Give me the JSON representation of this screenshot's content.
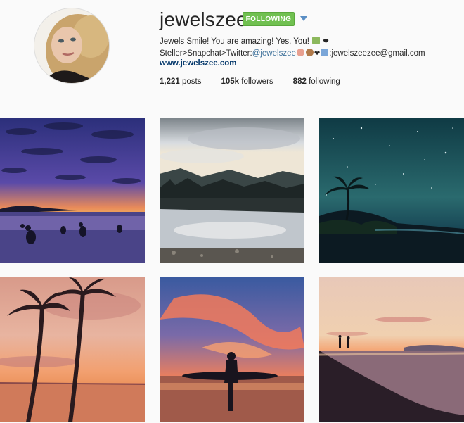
{
  "profile": {
    "username": "jewelszee",
    "follow_button_label": "FOLLOWING",
    "bio_line1": "Jewels Smile! You are amazing! Yes, You!",
    "bio_line2_prefix": "Steller>Snapchat>Twitter:",
    "bio_twitter": "@jewelszee",
    "bio_email": ":jewelszeezee@gmail.com",
    "website": "www.jewelszee.com"
  },
  "stats": {
    "posts_count": "1,221",
    "posts_label": "posts",
    "followers_count": "105k",
    "followers_label": "followers",
    "following_count": "882",
    "following_label": "following"
  },
  "colors": {
    "follow_green": "#70c050",
    "link_blue": "#3f729b",
    "website_blue": "#003569"
  },
  "posts": [
    {
      "scene": "sunset beach with kangaroos"
    },
    {
      "scene": "mountain lake reflection"
    },
    {
      "scene": "starry night palm tree beach"
    },
    {
      "scene": "palm trees silhouette at sunset"
    },
    {
      "scene": "surfer silhouette with surfboard at sunset"
    },
    {
      "scene": "couple walking on beach at dusk"
    }
  ]
}
